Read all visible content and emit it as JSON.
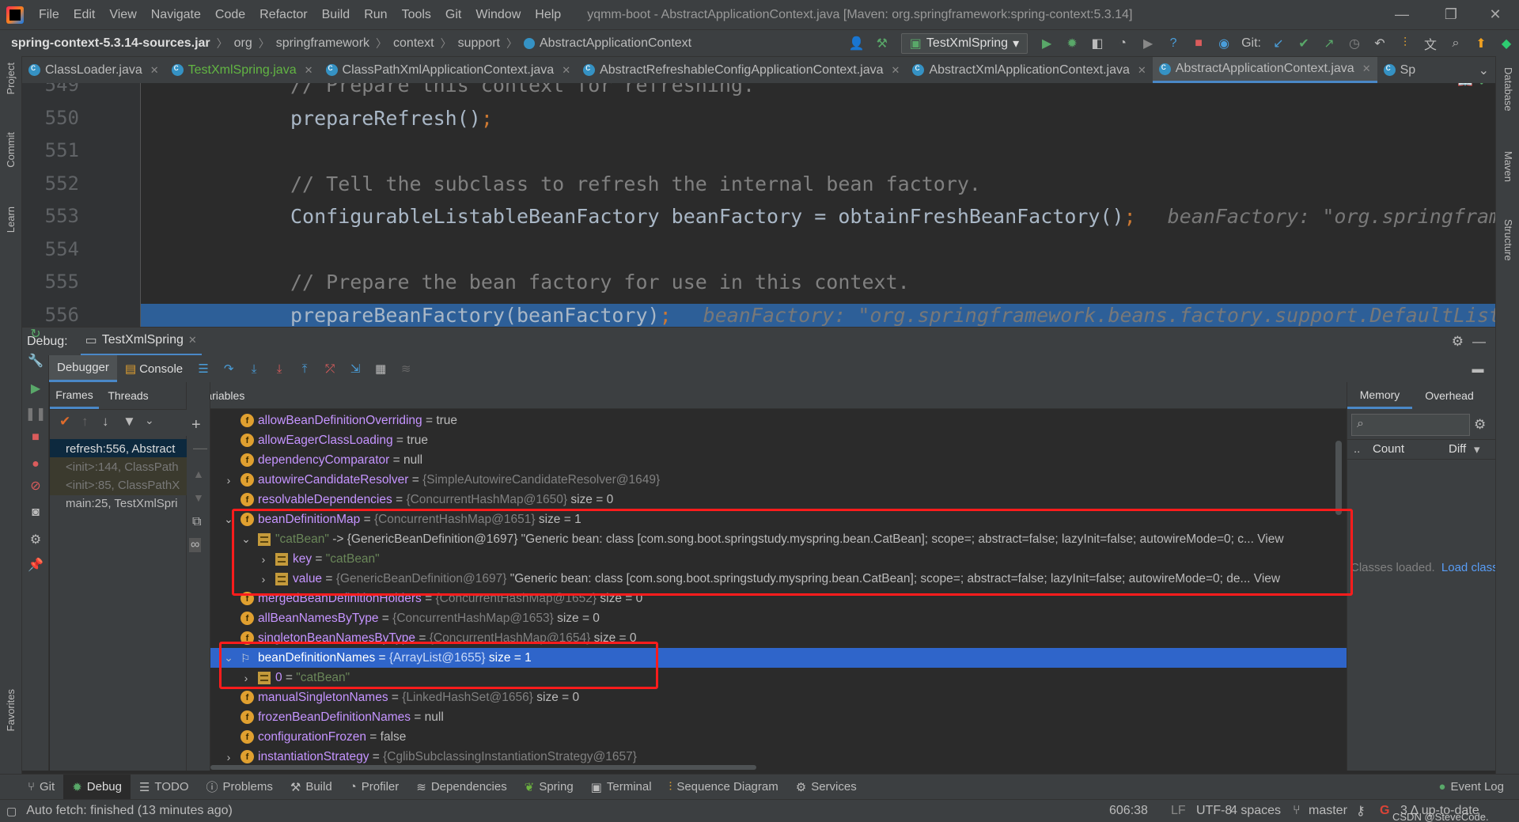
{
  "window": {
    "title": "yqmm-boot - AbstractApplicationContext.java [Maven: org.springframework:spring-context:5.3.14]",
    "menu": [
      "File",
      "Edit",
      "View",
      "Navigate",
      "Code",
      "Refactor",
      "Build",
      "Run",
      "Tools",
      "Git",
      "Window",
      "Help"
    ]
  },
  "breadcrumb": [
    "spring-context-5.3.14-sources.jar",
    "org",
    "springframework",
    "context",
    "support",
    "AbstractApplicationContext"
  ],
  "run_config": "TestXmlSpring",
  "git_label": "Git:",
  "editor_tabs": [
    {
      "label": "ClassLoader.java",
      "active": false
    },
    {
      "label": "TestXmlSpring.java",
      "active": false
    },
    {
      "label": "ClassPathXmlApplicationContext.java",
      "active": false
    },
    {
      "label": "AbstractRefreshableConfigApplicationContext.java",
      "active": false
    },
    {
      "label": "AbstractXmlApplicationContext.java",
      "active": false
    },
    {
      "label": "AbstractApplicationContext.java",
      "active": true
    },
    {
      "label": "Sp",
      "active": false
    }
  ],
  "left_stripe": [
    "Project",
    "Commit",
    "Learn",
    "Favorites"
  ],
  "right_stripe": [
    "Database",
    "Maven",
    "Structure"
  ],
  "code": {
    "line_numbers": [
      "549",
      "550",
      "551",
      "552",
      "553",
      "554",
      "555",
      "556"
    ],
    "lines": [
      {
        "text": "// Prepare this context for refreshing.",
        "kind": "comment",
        "hint": ""
      },
      {
        "text": "prepareRefresh()",
        "kind": "code",
        "hint": ""
      },
      {
        "text": "",
        "kind": "code",
        "hint": ""
      },
      {
        "text": "// Tell the subclass to refresh the internal bean factory.",
        "kind": "comment",
        "hint": ""
      },
      {
        "text": "ConfigurableListableBeanFactory beanFactory = obtainFreshBeanFactory()",
        "kind": "code",
        "hint": "beanFactory: \"org.springframe"
      },
      {
        "text": "",
        "kind": "code",
        "hint": ""
      },
      {
        "text": "// Prepare the bean factory for use in this context.",
        "kind": "comment",
        "hint": ""
      },
      {
        "text": "prepareBeanFactory(beanFactory)",
        "kind": "code",
        "hint": "beanFactory: \"org.springframework.beans.factory.support.DefaultListe"
      }
    ]
  },
  "debug": {
    "label": "Debug:",
    "session": "TestXmlSpring",
    "tabs": [
      "Debugger",
      "Console"
    ],
    "subtabs": [
      "Frames",
      "Threads"
    ],
    "variables_label": "Variables",
    "frames": [
      {
        "text": "refresh:556, Abstract",
        "style": "sel"
      },
      {
        "text": "<init>:144, ClassPath",
        "style": "dim"
      },
      {
        "text": "<init>:85, ClassPathX",
        "style": "dim"
      },
      {
        "text": "main:25, TestXmlSpri",
        "style": "normal"
      }
    ],
    "variables": [
      {
        "indent": 0,
        "arrow": "",
        "icon": "f",
        "name": "allowBeanDefinitionOverriding",
        "eq": " = ",
        "type": "",
        "value": "true",
        "str": "",
        "tail": ""
      },
      {
        "indent": 0,
        "arrow": "",
        "icon": "f",
        "name": "allowEagerClassLoading",
        "eq": " = ",
        "type": "",
        "value": "true",
        "str": "",
        "tail": ""
      },
      {
        "indent": 0,
        "arrow": "",
        "icon": "f",
        "name": "dependencyComparator",
        "eq": " = ",
        "type": "",
        "value": "null",
        "str": "",
        "tail": ""
      },
      {
        "indent": 0,
        "arrow": "›",
        "icon": "f",
        "name": "autowireCandidateResolver",
        "eq": " = ",
        "type": "{SimpleAutowireCandidateResolver@1649}",
        "value": "",
        "str": "",
        "tail": ""
      },
      {
        "indent": 0,
        "arrow": "",
        "icon": "f",
        "name": "resolvableDependencies",
        "eq": " = ",
        "type": "{ConcurrentHashMap@1650}",
        "value": " size = 0",
        "str": "",
        "tail": ""
      },
      {
        "indent": 0,
        "arrow": "⌄",
        "icon": "f",
        "name": "beanDefinitionMap",
        "eq": " = ",
        "type": "{ConcurrentHashMap@1651}",
        "value": " size = 1",
        "str": "",
        "tail": ""
      },
      {
        "indent": 1,
        "arrow": "⌄",
        "icon": "e",
        "name": "",
        "eq": "",
        "type": "",
        "value": "",
        "str": "\"catBean\"",
        "tail": " -> {GenericBeanDefinition@1697} \"Generic bean: class [com.song.boot.springstudy.myspring.bean.CatBean]; scope=; abstract=false; lazyInit=false; autowireMode=0; c... View"
      },
      {
        "indent": 2,
        "arrow": "›",
        "icon": "e",
        "name": "key",
        "eq": " = ",
        "type": "",
        "value": "",
        "str": "\"catBean\"",
        "tail": ""
      },
      {
        "indent": 2,
        "arrow": "›",
        "icon": "e",
        "name": "value",
        "eq": " = ",
        "type": "{GenericBeanDefinition@1697}",
        "value": " \"Generic bean: class [com.song.boot.springstudy.myspring.bean.CatBean]; scope=; abstract=false; lazyInit=false; autowireMode=0; de...",
        "str": "",
        "tail": " View"
      },
      {
        "indent": 0,
        "arrow": "",
        "icon": "f",
        "name": "mergedBeanDefinitionHolders",
        "eq": " = ",
        "type": "{ConcurrentHashMap@1652}",
        "value": " size = 0",
        "str": "",
        "tail": ""
      },
      {
        "indent": 0,
        "arrow": "",
        "icon": "f",
        "name": "allBeanNamesByType",
        "eq": " = ",
        "type": "{ConcurrentHashMap@1653}",
        "value": " size = 0",
        "str": "",
        "tail": ""
      },
      {
        "indent": 0,
        "arrow": "",
        "icon": "f",
        "name": "singletonBeanNamesByType",
        "eq": " = ",
        "type": "{ConcurrentHashMap@1654}",
        "value": " size = 0",
        "str": "",
        "tail": ""
      },
      {
        "indent": 0,
        "arrow": "⌄",
        "icon": "flag",
        "name": "beanDefinitionNames",
        "eq": " = ",
        "type": "{ArrayList@1655}",
        "value": " size = 1",
        "str": "",
        "tail": "",
        "selected": true
      },
      {
        "indent": 1,
        "arrow": "›",
        "icon": "e",
        "name": "0",
        "eq": " = ",
        "type": "",
        "value": "",
        "str": "\"catBean\"",
        "tail": ""
      },
      {
        "indent": 0,
        "arrow": "",
        "icon": "f",
        "name": "manualSingletonNames",
        "eq": " = ",
        "type": "{LinkedHashSet@1656}",
        "value": " size = 0",
        "str": "",
        "tail": ""
      },
      {
        "indent": 0,
        "arrow": "",
        "icon": "f",
        "name": "frozenBeanDefinitionNames",
        "eq": " = ",
        "type": "",
        "value": "null",
        "str": "",
        "tail": ""
      },
      {
        "indent": 0,
        "arrow": "",
        "icon": "f",
        "name": "configurationFrozen",
        "eq": " = ",
        "type": "",
        "value": "false",
        "str": "",
        "tail": ""
      },
      {
        "indent": 0,
        "arrow": "›",
        "icon": "f",
        "name": "instantiationStrategy",
        "eq": " = ",
        "type": "{CglibSubclassingInstantiationStrategy@1657}",
        "value": "",
        "str": "",
        "tail": ""
      }
    ],
    "memory": {
      "tabs": [
        "Memory",
        "Overhead"
      ],
      "columns": [
        "Count",
        "Diff"
      ],
      "classes_text": "Classes loaded.",
      "load_link": "Load class"
    }
  },
  "bottom_tools": [
    "Git",
    "Debug",
    "TODO",
    "Problems",
    "Build",
    "Profiler",
    "Dependencies",
    "Spring",
    "Terminal",
    "Sequence Diagram",
    "Services"
  ],
  "event_log": "Event Log",
  "status": {
    "message": "Auto fetch: finished (13 minutes ago)",
    "position": "606:38",
    "line_sep": "LF",
    "encoding": "UTF-8",
    "indent": "4 spaces",
    "branch": "master",
    "up_to_date": "3 Δ up-to-date",
    "watermark": "CSDN @SteveCode."
  }
}
